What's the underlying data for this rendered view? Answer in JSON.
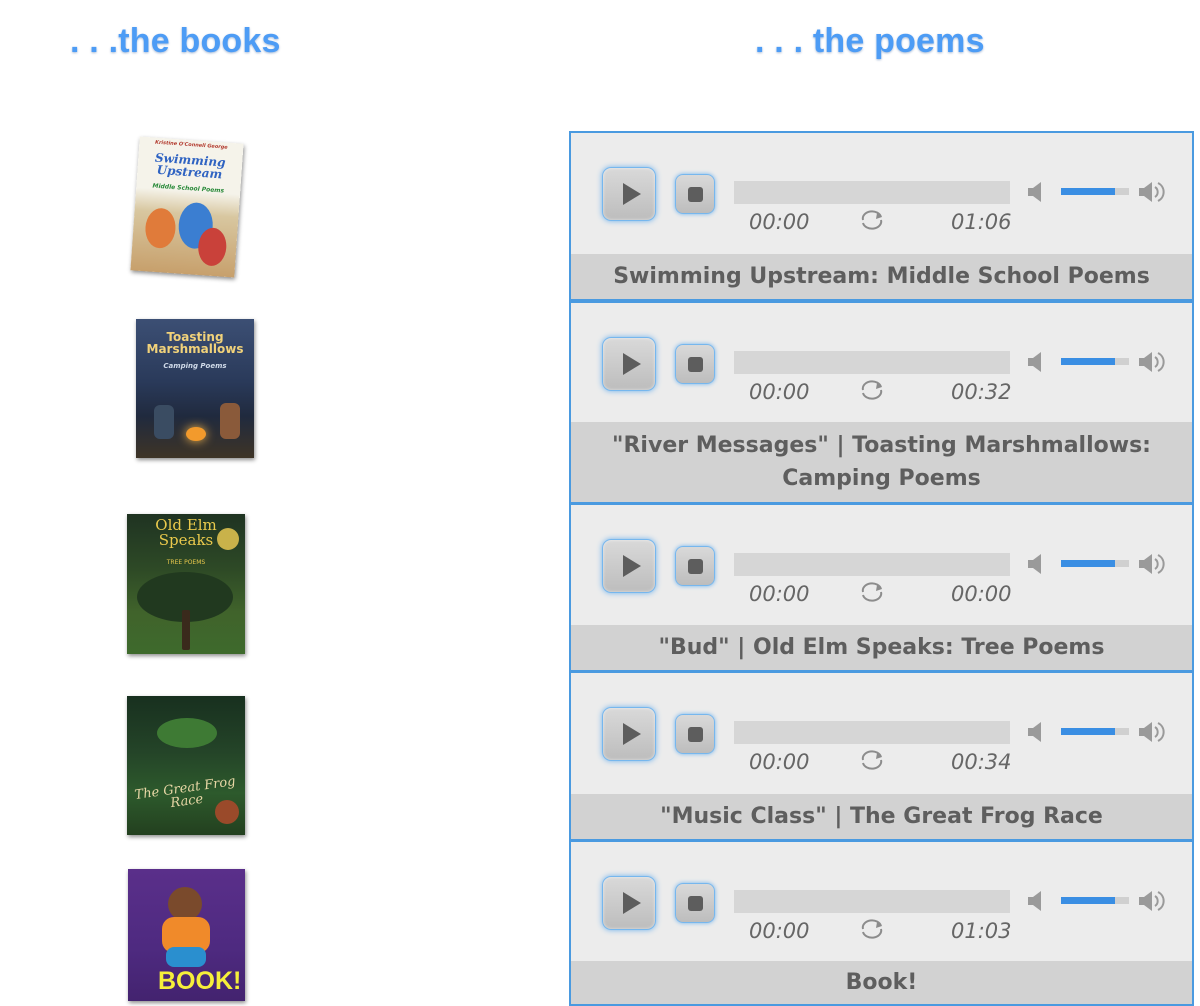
{
  "headings": {
    "books": ". . .the books",
    "poems": ". . . the poems"
  },
  "books": [
    {
      "title": "Swimming Upstream",
      "subtitle": "Middle School Poems",
      "top": "Kristine O'Connell George"
    },
    {
      "title": "Toasting Marshmallows",
      "subtitle": "Camping Poems"
    },
    {
      "title": "Old Elm Speaks",
      "subtitle": "TREE POEMS"
    },
    {
      "title": "The Great Frog Race"
    },
    {
      "title": "BOOK!"
    }
  ],
  "players": [
    {
      "current": "00:00",
      "duration": "01:06",
      "title": "Swimming Upstream: Middle School Poems",
      "volume": 0.8
    },
    {
      "current": "00:00",
      "duration": "00:32",
      "title": "\"River Messages\" | Toasting Marshmallows: Camping Poems",
      "volume": 0.8
    },
    {
      "current": "00:00",
      "duration": "00:00",
      "title": "\"Bud\" | Old Elm Speaks: Tree Poems",
      "volume": 0.8
    },
    {
      "current": "00:00",
      "duration": "00:34",
      "title": "\"Music Class\" | The Great Frog Race",
      "volume": 0.8
    },
    {
      "current": "00:00",
      "duration": "01:03",
      "title": "Book!",
      "volume": 0.8
    }
  ],
  "colors": {
    "heading": "#4d9cf5",
    "player_border": "#4a9ae0",
    "volume_fill": "#3a8ee3"
  },
  "icons": [
    "play-icon",
    "stop-icon",
    "repeat-icon",
    "mute-icon",
    "volume-max-icon"
  ]
}
